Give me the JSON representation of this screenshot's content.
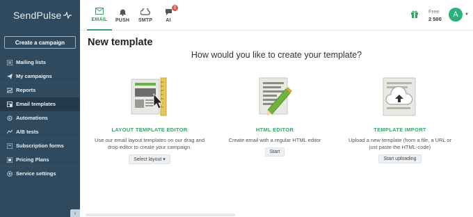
{
  "brand": {
    "logo_text": "SendPulse"
  },
  "sidebar": {
    "create_button": "Create a campaign",
    "items": [
      {
        "label": "Mailing lists",
        "icon": "list-icon",
        "active": false
      },
      {
        "label": "My campaigns",
        "icon": "send-icon",
        "active": false
      },
      {
        "label": "Reports",
        "icon": "report-icon",
        "active": false
      },
      {
        "label": "Email templates",
        "icon": "template-icon",
        "active": true
      },
      {
        "label": "Automations",
        "icon": "automation-icon",
        "active": false
      },
      {
        "label": "A/B tests",
        "icon": "ab-test-icon",
        "active": false
      },
      {
        "label": "Subscription forms",
        "icon": "form-icon",
        "active": false
      },
      {
        "label": "Pricing Plans",
        "icon": "pricing-icon",
        "active": false
      },
      {
        "label": "Service settings",
        "icon": "settings-icon",
        "active": false
      }
    ],
    "collapse_glyph": "‹"
  },
  "topbar": {
    "tabs": [
      {
        "label": "EMAIL",
        "icon": "email-icon",
        "active": true
      },
      {
        "label": "PUSH",
        "icon": "bell-icon",
        "active": false
      },
      {
        "label": "SMTP",
        "icon": "cloud-icon",
        "active": false
      },
      {
        "label": "AI",
        "icon": "ai-chat-icon",
        "active": false,
        "badge": "0"
      }
    ],
    "plan_name": "Free",
    "plan_count": "2 500",
    "avatar_initial": "A"
  },
  "main": {
    "title": "New template",
    "subtitle": "How would you like to create your template?",
    "options": [
      {
        "title": "LAYOUT TEMPLATE EDITOR",
        "description": "Use our email layout templates on our drag and drop editor to create your campaign.",
        "button": "Select layout ▾",
        "illustration": "layout-editor-icon"
      },
      {
        "title": "HTML EDITOR",
        "description": "Create email with a regular HTML editor",
        "button": "Start",
        "illustration": "html-editor-icon"
      },
      {
        "title": "TEMPLATE IMPORT",
        "description": "Upload a new template (from a file, a URL or just paste the HTML-code)",
        "button": "Start uploading",
        "illustration": "upload-icon"
      }
    ]
  },
  "colors": {
    "sidebar_bg": "#2f4a5f",
    "accent_green": "#3aa36b",
    "avatar_bg": "#2fae7e",
    "badge_red": "#e0574f"
  }
}
